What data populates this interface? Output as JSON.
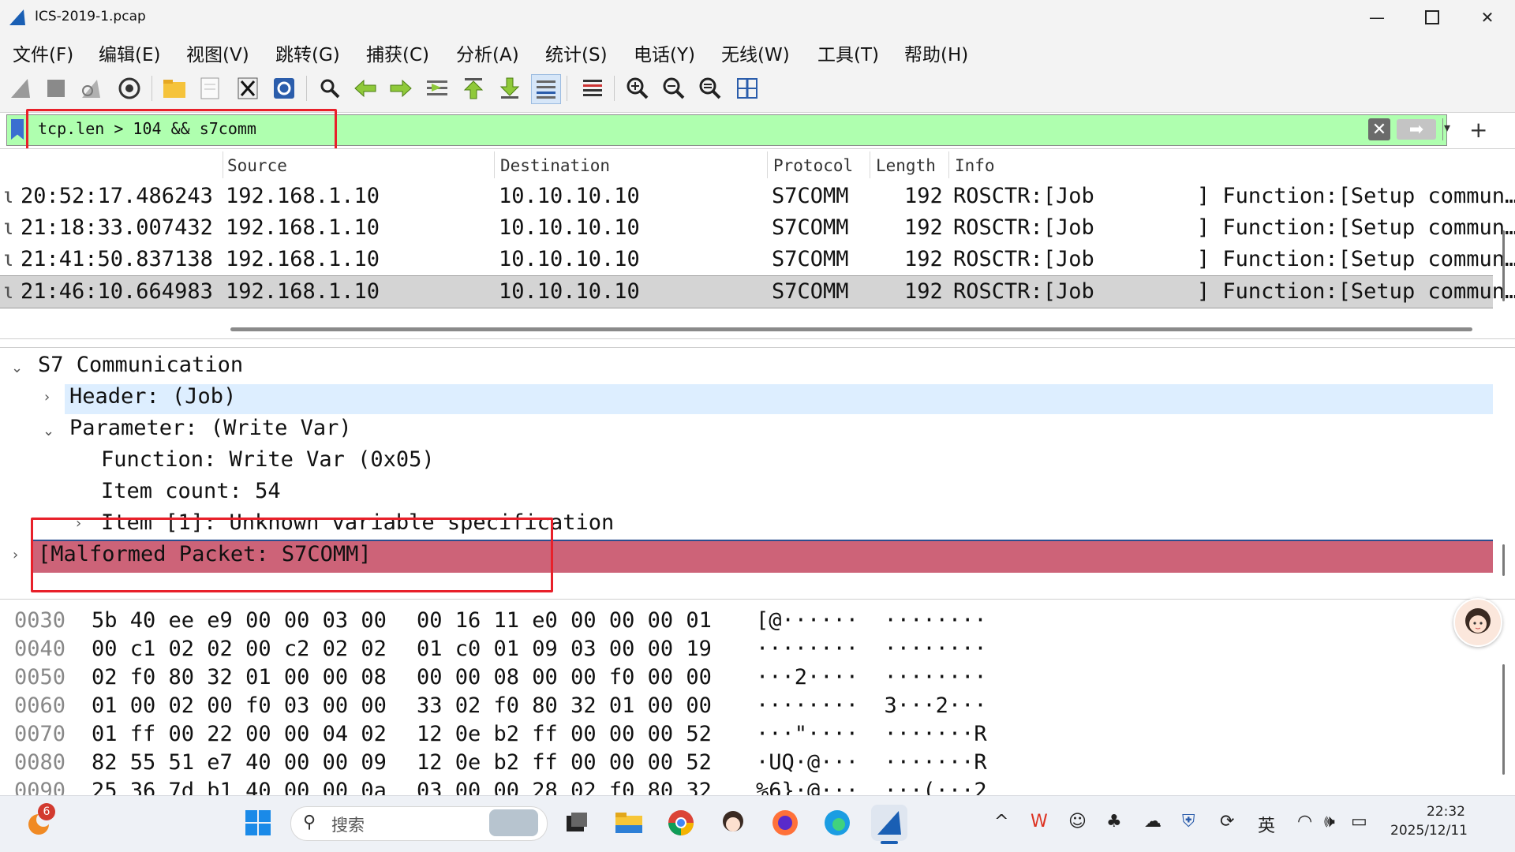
{
  "window": {
    "title": "ICS-2019-1.pcap"
  },
  "menu": [
    "文件(F)",
    "编辑(E)",
    "视图(V)",
    "跳转(G)",
    "捕获(C)",
    "分析(A)",
    "统计(S)",
    "电话(Y)",
    "无线(W)",
    "工具(T)",
    "帮助(H)"
  ],
  "toolbar_icons": [
    "shark-fin-start-icon",
    "stop-icon",
    "restart-icon",
    "gear-icon",
    "folder-icon",
    "file-icon",
    "close-file-icon",
    "reload-icon",
    "search-icon",
    "back-arrow-icon",
    "forward-arrow-icon",
    "go-to-packet-icon",
    "first-packet-icon",
    "last-packet-icon",
    "autoscroll-icon",
    "colorize-icon",
    "zoom-in-icon",
    "zoom-out-icon",
    "zoom-reset-icon",
    "resize-columns-icon"
  ],
  "filter": {
    "text": "tcp.len > 104 && s7comm"
  },
  "packet_list": {
    "columns": {
      "source": "Source",
      "destination": "Destination",
      "protocol": "Protocol",
      "length": "Length",
      "info": "Info"
    },
    "rows": [
      {
        "time": "20:52:17.486243",
        "source": "192.168.1.10",
        "destination": "10.10.10.10",
        "protocol": "S7COMM",
        "length": "192",
        "info": "ROSCTR:[Job        ] Function:[Setup commun…"
      },
      {
        "time": "21:18:33.007432",
        "source": "192.168.1.10",
        "destination": "10.10.10.10",
        "protocol": "S7COMM",
        "length": "192",
        "info": "ROSCTR:[Job        ] Function:[Setup commun…"
      },
      {
        "time": "21:41:50.837138",
        "source": "192.168.1.10",
        "destination": "10.10.10.10",
        "protocol": "S7COMM",
        "length": "192",
        "info": "ROSCTR:[Job        ] Function:[Setup commun…"
      },
      {
        "time": "21:46:10.664983",
        "source": "192.168.1.10",
        "destination": "10.10.10.10",
        "protocol": "S7COMM",
        "length": "192",
        "info": "ROSCTR:[Job        ] Function:[Setup commun…"
      }
    ]
  },
  "details": {
    "s7": "S7 Communication",
    "header": "Header: (Job)",
    "parameter": "Parameter: (Write Var)",
    "function": "Function: Write Var (0x05)",
    "item_count": "Item count: 54",
    "item1": "Item [1]: Unknown variable specification",
    "malformed": "[Malformed Packet: S7COMM]"
  },
  "bytes": [
    {
      "offset": "0030",
      "hex1": "5b 40 ee e9 00 00 03 00",
      "hex2": "00 16 11 e0 00 00 00 01",
      "ascii": "[@······  ········"
    },
    {
      "offset": "0040",
      "hex1": "00 c1 02 02 00 c2 02 02",
      "hex2": "01 c0 01 09 03 00 00 19",
      "ascii": "········  ········"
    },
    {
      "offset": "0050",
      "hex1": "02 f0 80 32 01 00 00 08",
      "hex2": "00 00 08 00 00 f0 00 00",
      "ascii": "···2····  ········"
    },
    {
      "offset": "0060",
      "hex1": "01 00 02 00 f0 03 00 00",
      "hex2": "33 02 f0 80 32 01 00 00",
      "ascii": "········  3···2···"
    },
    {
      "offset": "0070",
      "hex1": "01 ff 00 22 00 00 04 02",
      "hex2": "12 0e b2 ff 00 00 00 52",
      "ascii": "···\"····  ·······R"
    },
    {
      "offset": "0080",
      "hex1": "82 55 51 e7 40 00 00 09",
      "hex2": "12 0e b2 ff 00 00 00 52",
      "ascii": "·UQ·@···  ·······R"
    },
    {
      "offset": "0090",
      "hex1": "25 36 7d b1 40 00 00 0a",
      "hex2": "03 00 00 28 02 f0 80 32",
      "ascii": "%6}·@···  ···(···2"
    }
  ],
  "taskbar": {
    "search_placeholder": "搜索",
    "notification_badge": "6",
    "ime": "英",
    "time": "22:32",
    "date": "2025/12/11"
  },
  "colors": {
    "filter_bg": "#afffaf",
    "malformed_bg": "#cd6378",
    "highlight_bg": "#ddeeff",
    "selected_row": "#d4d4d4",
    "annotation": "#e8202a"
  }
}
